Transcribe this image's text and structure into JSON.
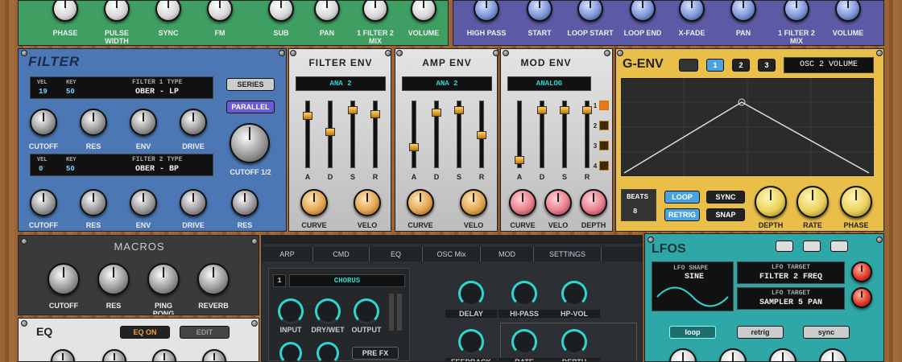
{
  "osc": {
    "labels": [
      "PHASE",
      "PULSE\nWIDTH",
      "SYNC",
      "FM",
      "SUB",
      "PAN",
      "1 FILTER 2\nMIX",
      "VOLUME"
    ]
  },
  "sampler": {
    "labels": [
      "HIGH PASS",
      "START",
      "LOOP START",
      "LOOP END",
      "X-FADE",
      "PAN",
      "1 FILTER 2\nMIX",
      "VOLUME"
    ]
  },
  "filter": {
    "title": "FILTER",
    "f1": {
      "vel_label": "VEL",
      "vel": "19",
      "key_label": "KEY",
      "key": "50",
      "type_label": "FILTER 1 TYPE",
      "type": "OBER - LP"
    },
    "f2": {
      "vel_label": "VEL",
      "vel": "0",
      "key_label": "KEY",
      "key": "50",
      "type_label": "FILTER 2 TYPE",
      "type": "OBER - BP"
    },
    "series": "SERIES",
    "parallel": "PARALLEL",
    "cutoff12": "CUTOFF 1/2",
    "row1": [
      "CUTOFF",
      "RES",
      "ENV",
      "DRIVE"
    ],
    "row2": [
      "CUTOFF",
      "RES",
      "ENV",
      "DRIVE",
      "RES"
    ]
  },
  "envs": [
    {
      "title": "FILTER ENV",
      "preset": "ANA 2",
      "faders": [
        "A",
        "D",
        "S",
        "R"
      ],
      "knobs": [
        "CURVE",
        "VELO"
      ],
      "levels": [
        0.82,
        0.55,
        0.92,
        0.85
      ]
    },
    {
      "title": "AMP ENV",
      "preset": "ANA 2",
      "faders": [
        "A",
        "D",
        "S",
        "R"
      ],
      "knobs": [
        "CURVE",
        "VELO"
      ],
      "levels": [
        0.3,
        0.88,
        0.92,
        0.5
      ]
    },
    {
      "title": "MOD ENV",
      "preset": "ANALOG",
      "faders": [
        "A",
        "D",
        "S",
        "R"
      ],
      "knobs": [
        "CURVE",
        "VELO",
        "DEPTH"
      ],
      "levels": [
        0.08,
        0.92,
        0.92,
        0.92
      ],
      "slots": [
        "1",
        "2",
        "3",
        "4"
      ]
    }
  ],
  "genv": {
    "title": "G-ENV",
    "tabs": [
      "1",
      "2",
      "3"
    ],
    "target": "OSC 2 VOLUME",
    "beats_label": "BEATS",
    "beats": "8",
    "loop": "LOOP",
    "sync": "SYNC",
    "retrig": "RETRIG",
    "snap": "SNAP",
    "knobs": [
      "DEPTH",
      "RATE",
      "PHASE"
    ]
  },
  "macros": {
    "title": "MACROS",
    "knobs": [
      "CUTOFF",
      "RES",
      "PING\nPONG",
      "REVERB"
    ]
  },
  "eq": {
    "title": "EQ",
    "on": "EQ ON",
    "edit": "EDIT"
  },
  "fx": {
    "tabs": [
      "ARP",
      "CMD",
      "EQ",
      "OSC Mix",
      "MOD",
      "SETTINGS"
    ],
    "slot": "1",
    "effect": "CHORUS",
    "knobs": [
      "INPUT",
      "DRY/WET",
      "OUTPUT"
    ],
    "prefx": "PRE FX",
    "params": [
      "DELAY",
      "HI-PASS",
      "HP-VOL",
      "FEEDBACK",
      "RATE",
      "DEPTH"
    ]
  },
  "lfos": {
    "title": "LFOS",
    "shape_label": "LFO SHAPE",
    "shape": "SINE",
    "t1_label": "LFO TARGET",
    "t1": "FILTER 2 FREQ",
    "t2_label": "LFO TARGET",
    "t2": "SAMPLER 5 PAN",
    "loop": "loop",
    "retrig": "retrig",
    "sync": "sync"
  }
}
